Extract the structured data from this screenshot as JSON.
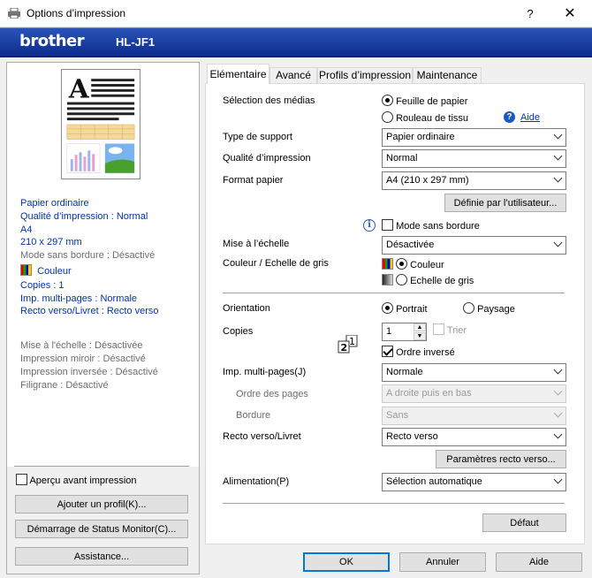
{
  "window": {
    "title": "Options d’impression",
    "help": "?",
    "close": "✕"
  },
  "banner": {
    "brand": "brother",
    "model": "HL-JF1"
  },
  "summary": {
    "media": "Papier ordinaire",
    "quality": "Qualité d’impression : Normal",
    "size": "A4",
    "dims": "210 x 297 mm",
    "borderless": "Mode sans bordure : Désactivé",
    "color": "Couleur",
    "copies": "Copies : 1",
    "multipage": "Imp. multi-pages : Normale",
    "duplex": "Recto verso/Livret : Recto verso",
    "scaling": "Mise à l'échelle : Désactivée",
    "mirror": "Impression miroir : Désactivé",
    "reverse": "Impression inversée : Désactivé",
    "watermark": "Filigrane : Désactivé"
  },
  "left_controls": {
    "preview_label": "Aperçu avant impression",
    "add_profile": "Ajouter un profil(K)...",
    "status_monitor": "Démarrage de Status Monitor(C)...",
    "assistance": "Assistance..."
  },
  "tabs": [
    "Elémentaire",
    "Avancé",
    "Profils d’impression",
    "Maintenance"
  ],
  "basic": {
    "media_selection_label": "Sélection des médias",
    "media_sheet": "Feuille de papier",
    "media_roll": "Rouleau de tissu",
    "help_link": "Aide",
    "support_type_label": "Type de support",
    "support_type_value": "Papier ordinaire",
    "quality_label": "Qualité d’impression",
    "quality_value": "Normal",
    "paper_size_label": "Format papier",
    "paper_size_value": "A4 (210 x 297 mm)",
    "user_defined_btn": "Définie par l’utilisateur...",
    "borderless_label": "Mode sans bordure",
    "scaling_label": "Mise à l’échelle",
    "scaling_value": "Désactivée",
    "color_mode_label": "Couleur / Echelle de gris",
    "color_option": "Couleur",
    "gray_option": "Echelle de gris",
    "orientation_label": "Orientation",
    "portrait": "Portrait",
    "landscape": "Paysage",
    "copies_label": "Copies",
    "copies_value": "1",
    "collate_label": "Trier",
    "reverse_order_label": "Ordre inversé",
    "multipage_label": "Imp. multi-pages(J)",
    "multipage_value": "Normale",
    "page_order_label": "Ordre des pages",
    "page_order_value": "A droite puis en bas",
    "border_label": "Bordure",
    "border_value": "Sans",
    "duplex_label": "Recto verso/Livret",
    "duplex_value": "Recto verso",
    "duplex_settings_btn": "Paramètres recto verso...",
    "feed_label": "Alimentation(P)",
    "feed_value": "Sélection automatique",
    "default_btn": "Défaut"
  },
  "footer": {
    "ok": "OK",
    "cancel": "Annuler",
    "help": "Aide"
  }
}
